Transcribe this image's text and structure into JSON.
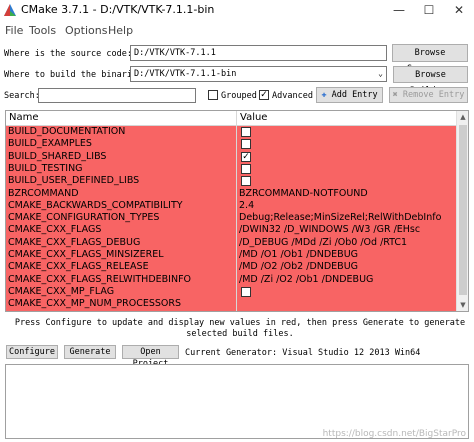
{
  "window": {
    "title": "CMake 3.7.1 - D:/VTK/VTK-7.1.1-bin"
  },
  "menu": [
    "File",
    "Tools",
    "Options",
    "Help"
  ],
  "source": {
    "label": "Where is the source code:",
    "value": "D:/VTK/VTK-7.1.1",
    "browse": "Browse Source..."
  },
  "build": {
    "label": "Where to build the binaries:",
    "value": "D:/VTK/VTK-7.1.1-bin",
    "browse": "Browse Build..."
  },
  "search": {
    "label": "Search:",
    "value": "",
    "grouped": "Grouped",
    "grouped_checked": false,
    "advanced": "Advanced",
    "advanced_checked": true,
    "add_entry": "Add Entry",
    "remove_entry": "Remove Entry"
  },
  "table": {
    "headers": [
      "Name",
      "Value"
    ],
    "highlight_color": "#f86464",
    "rows": [
      {
        "name": "BUILD_DOCUMENTATION",
        "type": "bool",
        "checked": false
      },
      {
        "name": "BUILD_EXAMPLES",
        "type": "bool",
        "checked": false
      },
      {
        "name": "BUILD_SHARED_LIBS",
        "type": "bool",
        "checked": true
      },
      {
        "name": "BUILD_TESTING",
        "type": "bool",
        "checked": false
      },
      {
        "name": "BUILD_USER_DEFINED_LIBS",
        "type": "bool",
        "checked": false
      },
      {
        "name": "BZRCOMMAND",
        "type": "text",
        "value": "BZRCOMMAND-NOTFOUND"
      },
      {
        "name": "CMAKE_BACKWARDS_COMPATIBILITY",
        "type": "text",
        "value": "2.4"
      },
      {
        "name": "CMAKE_CONFIGURATION_TYPES",
        "type": "text",
        "value": "Debug;Release;MinSizeRel;RelWithDebInfo"
      },
      {
        "name": "CMAKE_CXX_FLAGS",
        "type": "text",
        "value": "/DWIN32 /D_WINDOWS /W3 /GR /EHsc"
      },
      {
        "name": "CMAKE_CXX_FLAGS_DEBUG",
        "type": "text",
        "value": "/D_DEBUG /MDd /Zi /Ob0 /Od /RTC1"
      },
      {
        "name": "CMAKE_CXX_FLAGS_MINSIZEREL",
        "type": "text",
        "value": "/MD /O1 /Ob1 /DNDEBUG"
      },
      {
        "name": "CMAKE_CXX_FLAGS_RELEASE",
        "type": "text",
        "value": "/MD /O2 /Ob2 /DNDEBUG"
      },
      {
        "name": "CMAKE_CXX_FLAGS_RELWITHDEBINFO",
        "type": "text",
        "value": "/MD /Zi /O2 /Ob1 /DNDEBUG"
      },
      {
        "name": "CMAKE_CXX_MP_FLAG",
        "type": "bool",
        "checked": false
      },
      {
        "name": "CMAKE_CXX_MP_NUM_PROCESSORS",
        "type": "text",
        "value": ""
      }
    ]
  },
  "message": "Press Configure to update and display new values in red, then press Generate to generate selected build files.",
  "actions": {
    "configure": "Configure",
    "generate": "Generate",
    "open_project": "Open Project",
    "current_generator": "Current Generator: Visual Studio 12 2013 Win64"
  },
  "watermark": "https://blog.csdn.net/BigStarPro"
}
